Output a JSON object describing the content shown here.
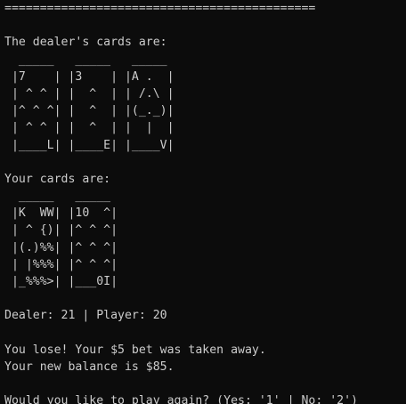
{
  "terminal": {
    "divider": "============================================",
    "dealer_heading": "The dealer's cards are:",
    "dealer_cards_art": [
      "  _____   _____   _____",
      " |7    | |3    | |A .  |",
      " | ^ ^ | |  ^  | | /.\\ |",
      " |^ ^ ^| |  ^  | |(_._)|",
      " | ^ ^ | |  ^  | |  |  |",
      " |____L| |____E| |____V|"
    ],
    "player_heading": "Your cards are:",
    "player_cards_art": [
      "  _____   _____",
      " |K  WW| |10  ^|",
      " | ^ {)| |^ ^ ^|",
      " |(.)%%| |^ ^ ^|",
      " | |%%%| |^ ^ ^|",
      " |_%%%>| |___0I|"
    ],
    "score_line": "Dealer: 21 | Player: 20",
    "result_line": "You lose! Your $5 bet was taken away.",
    "balance_line": "Your new balance is $85.",
    "prompt_line": "Would you like to play again? (Yes: '1' | No: '2')"
  },
  "colors": {
    "background": "#0c0c0c",
    "text": "#cccccc"
  }
}
